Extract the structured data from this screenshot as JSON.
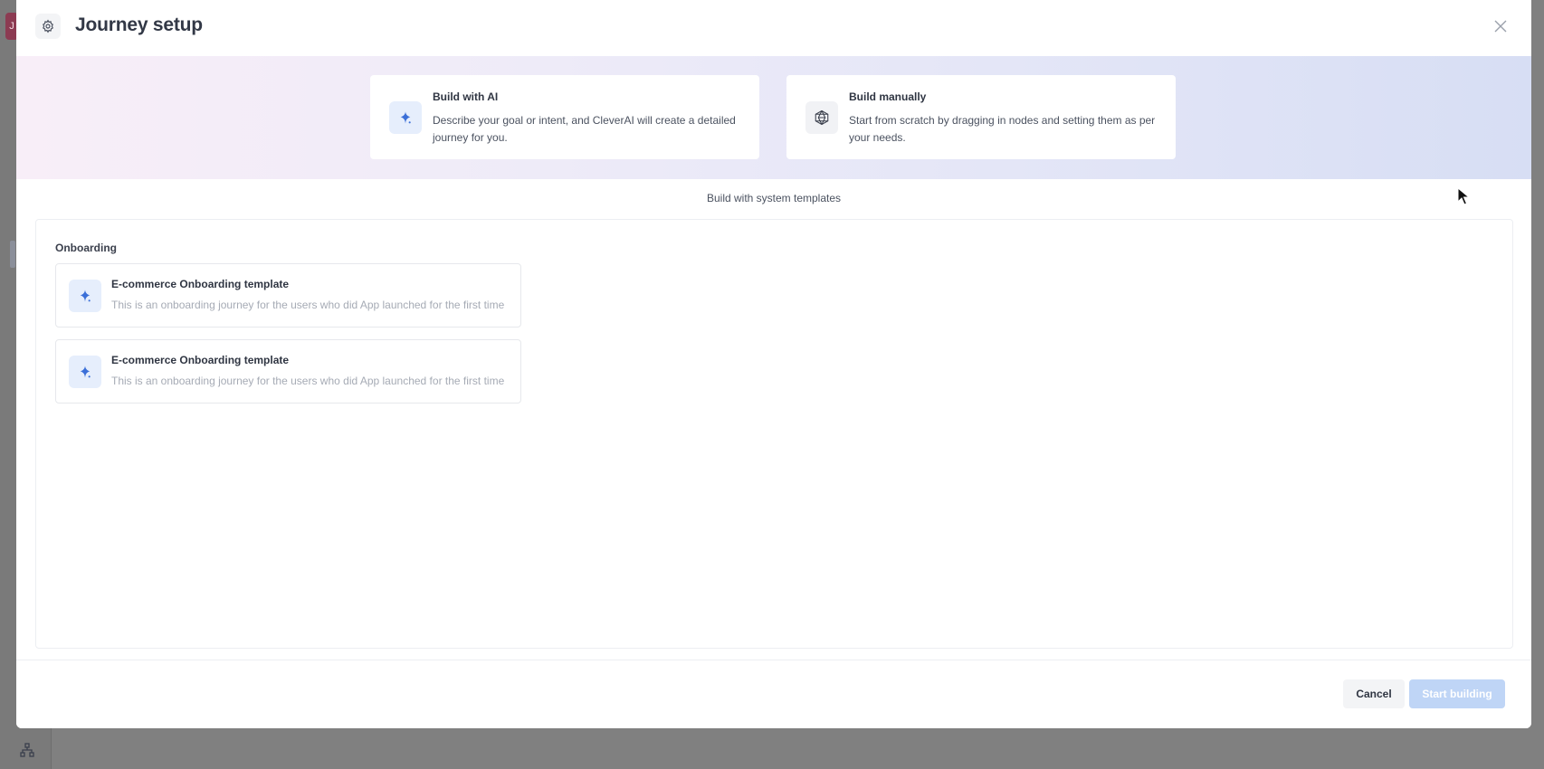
{
  "background": {
    "avatar_letter": "J"
  },
  "modal": {
    "title": "Journey setup",
    "header_icon": "gear-icon",
    "close_icon": "close-icon"
  },
  "build_options": {
    "ai": {
      "title": "Build with AI",
      "description": "Describe your goal or intent, and CleverAI will create a detailed journey for you.",
      "icon": "sparkle-icon"
    },
    "manual": {
      "title": "Build manually",
      "description": "Start from scratch by dragging in nodes and setting them as per your needs.",
      "icon": "network-icon"
    }
  },
  "templates": {
    "heading": "Build with system templates",
    "section_label": "Onboarding",
    "items": [
      {
        "title": "E-commerce Onboarding template",
        "description": "This is an onboarding journey for the users who did App launched for the first time",
        "icon": "sparkle-icon"
      },
      {
        "title": "E-commerce Onboarding template",
        "description": "This is an onboarding journey for the users who did App launched for the first time",
        "icon": "sparkle-icon"
      }
    ]
  },
  "footer": {
    "cancel_label": "Cancel",
    "start_label": "Start building"
  },
  "colors": {
    "accent": "#3b6fd8",
    "accent_disabled": "#bfd5f6",
    "hero_gradient_start": "#f8eef8",
    "hero_gradient_end": "#d7def4"
  }
}
